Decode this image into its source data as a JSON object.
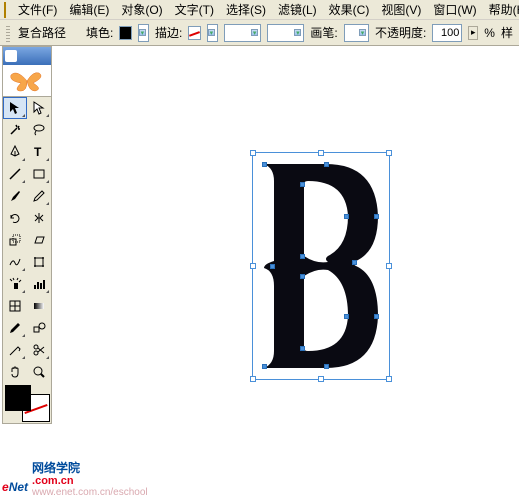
{
  "menu": {
    "file": "文件(F)",
    "edit": "编辑(E)",
    "object": "对象(O)",
    "type": "文字(T)",
    "select": "选择(S)",
    "filter": "滤镜(L)",
    "effect": "效果(C)",
    "view": "视图(V)",
    "window": "窗口(W)",
    "help": "帮助(H)"
  },
  "toolbar": {
    "path_label": "复合路径",
    "fill_label": "填色:",
    "stroke_label": "描边:",
    "brush_label": "画笔:",
    "opacity_label": "不透明度:",
    "opacity_value": "100",
    "opacity_suffix": "%",
    "style_label": "样"
  },
  "watermark": {
    "brand_e": "e",
    "brand_net": "Net",
    "cn": "网络学院",
    "url1": ".com.cn",
    "url2": "www.enet.com.cn/eschool"
  },
  "icons": {
    "selection": "selection-tool",
    "direct": "direct-selection-tool",
    "wand": "magic-wand-tool",
    "lasso": "lasso-tool",
    "pen": "pen-tool",
    "type": "type-tool",
    "line": "line-tool",
    "rect": "rectangle-tool",
    "brush": "paintbrush-tool",
    "pencil": "pencil-tool",
    "rotate": "rotate-tool",
    "reflect": "reflect-tool",
    "scale": "scale-tool",
    "shear": "shear-tool",
    "warp": "warp-tool",
    "freetrans": "free-transform-tool",
    "symbol": "symbol-sprayer-tool",
    "graph": "column-graph-tool",
    "mesh": "mesh-tool",
    "gradient": "gradient-tool",
    "eyedrop": "eyedropper-tool",
    "blend": "blend-tool",
    "slice": "slice-tool",
    "scissors": "scissors-tool",
    "hand": "hand-tool",
    "zoom": "zoom-tool"
  }
}
